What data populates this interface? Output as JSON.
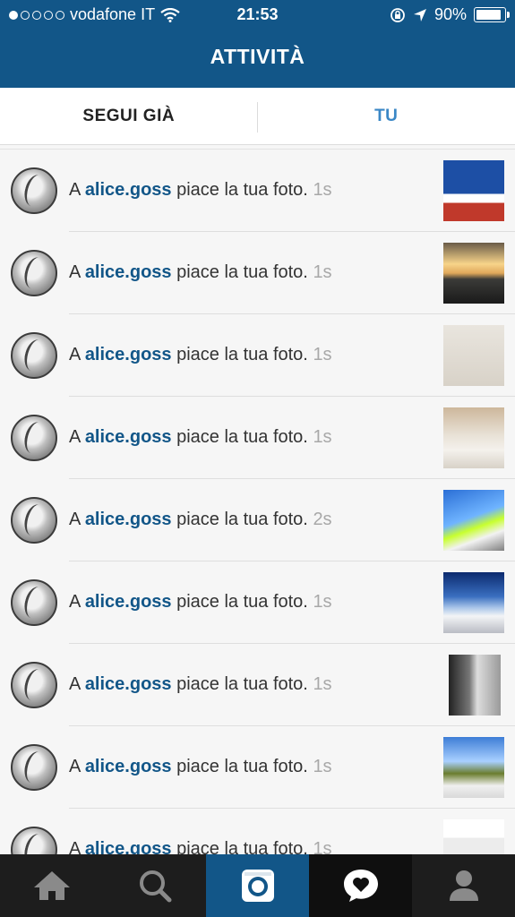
{
  "status_bar": {
    "carrier": "vodafone IT",
    "time": "21:53",
    "battery": "90%",
    "battery_level": 0.9
  },
  "header": {
    "title": "ATTIVITÀ"
  },
  "tabs": [
    {
      "label": "SEGUI GIÀ",
      "active": false
    },
    {
      "label": "TU",
      "active": true
    }
  ],
  "notifications": [
    {
      "prefix": "A",
      "user": "alice.goss",
      "action": "piace la tua foto.",
      "time": "1s"
    },
    {
      "prefix": "A",
      "user": "alice.goss",
      "action": "piace la tua foto.",
      "time": "1s"
    },
    {
      "prefix": "A",
      "user": "alice.goss",
      "action": "piace la tua foto.",
      "time": "1s"
    },
    {
      "prefix": "A",
      "user": "alice.goss",
      "action": "piace la tua foto.",
      "time": "1s"
    },
    {
      "prefix": "A",
      "user": "alice.goss",
      "action": "piace la tua foto.",
      "time": "2s"
    },
    {
      "prefix": "A",
      "user": "alice.goss",
      "action": "piace la tua foto.",
      "time": "1s"
    },
    {
      "prefix": "A",
      "user": "alice.goss",
      "action": "piace la tua foto.",
      "time": "1s"
    },
    {
      "prefix": "A",
      "user": "alice.goss",
      "action": "piace la tua foto.",
      "time": "1s"
    },
    {
      "prefix": "A",
      "user": "alice.goss",
      "action": "piace la tua foto.",
      "time": "1s"
    }
  ],
  "bottom_nav": [
    {
      "icon": "home-icon",
      "active": false
    },
    {
      "icon": "search-icon",
      "active": false
    },
    {
      "icon": "camera-icon",
      "active": false
    },
    {
      "icon": "activity-heart-icon",
      "active": true
    },
    {
      "icon": "profile-icon",
      "active": false
    }
  ],
  "colors": {
    "brand_blue": "#125688",
    "active_tab": "#3a87c6",
    "username": "#125688",
    "timestamp": "#a8a8a8"
  }
}
